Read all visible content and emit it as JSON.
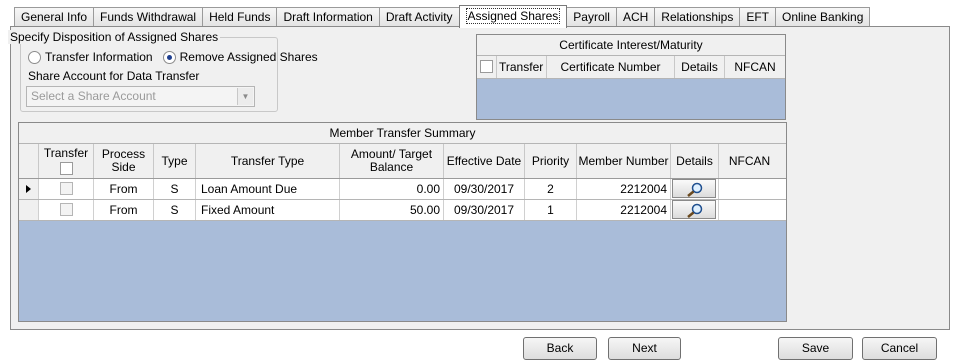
{
  "tabs": [
    "General Info",
    "Funds Withdrawal",
    "Held Funds",
    "Draft Information",
    "Draft Activity",
    "Assigned Shares",
    "Payroll",
    "ACH",
    "Relationships",
    "EFT",
    "Online Banking"
  ],
  "active_tab": "Assigned Shares",
  "disposition": {
    "title": "Specify Disposition of Assigned Shares",
    "option_transfer": "Transfer Information",
    "option_remove": "Remove Assigned Shares",
    "selected": "Remove Assigned Shares",
    "share_account_label": "Share Account for Data Transfer",
    "share_account_placeholder": "Select a Share Account"
  },
  "certificate_grid": {
    "caption": "Certificate Interest/Maturity",
    "columns": [
      "Transfer",
      "Certificate Number",
      "Details",
      "NFCAN"
    ]
  },
  "member_transfer": {
    "caption": "Member Transfer Summary",
    "columns": {
      "transfer": "Transfer",
      "process_side": "Process Side",
      "type": "Type",
      "transfer_type": "Transfer Type",
      "amount": "Amount/ Target Balance",
      "effective_date": "Effective Date",
      "priority": "Priority",
      "member_number": "Member Number",
      "details": "Details",
      "nfcan": "NFCAN"
    },
    "rows": [
      {
        "process_side": "From",
        "type": "S",
        "transfer_type": "Loan Amount Due",
        "amount": "0.00",
        "effective_date": "09/30/2017",
        "priority": "2",
        "member_number": "2212004",
        "nfcan": ""
      },
      {
        "process_side": "From",
        "type": "S",
        "transfer_type": "Fixed Amount",
        "amount": "50.00",
        "effective_date": "09/30/2017",
        "priority": "1",
        "member_number": "2212004",
        "nfcan": ""
      }
    ]
  },
  "buttons": {
    "back": "Back",
    "next": "Next",
    "save": "Save",
    "cancel": "Cancel"
  },
  "colors": {
    "grid_empty": "#a9bcd9",
    "panel": "#f0f0f0",
    "radio_dot": "#1f3f8f"
  }
}
